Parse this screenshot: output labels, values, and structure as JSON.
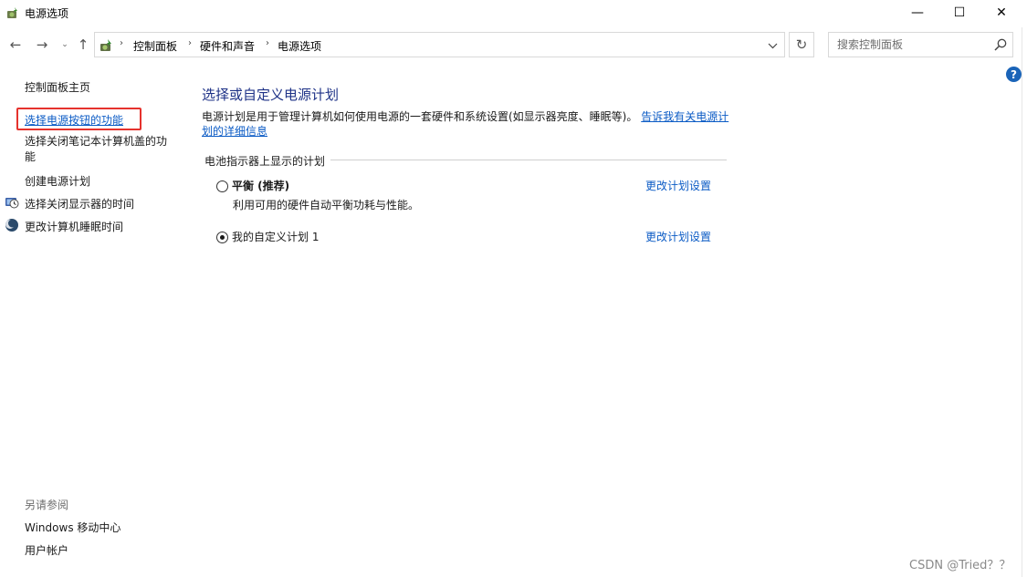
{
  "window": {
    "title": "电源选项",
    "minimize_glyph": "—",
    "maximize_glyph": "☐",
    "close_glyph": "✕"
  },
  "nav": {
    "back_glyph": "←",
    "forward_glyph": "→",
    "recent_glyph": "⌄",
    "up_glyph": "↑",
    "breadcrumbs": [
      "控制面板",
      "硬件和声音",
      "电源选项"
    ],
    "separator": "›",
    "refresh_glyph": "↻"
  },
  "search": {
    "placeholder": "搜索控制面板"
  },
  "help": {
    "glyph": "?"
  },
  "sidebar": {
    "home": "控制面板主页",
    "items": [
      {
        "label": "选择电源按钮的功能",
        "active": true
      },
      {
        "label": "选择关闭笔记本计算机盖的功能"
      },
      {
        "label": "创建电源计划"
      },
      {
        "label": "选择关闭显示器的时间",
        "icon": "monitor-clock-icon"
      },
      {
        "label": "更改计算机睡眠时间",
        "icon": "moon-icon"
      }
    ],
    "see_also_title": "另请参阅",
    "see_also": [
      "Windows 移动中心",
      "用户帐户"
    ]
  },
  "main": {
    "title": "选择或自定义电源计划",
    "description": "电源计划是用于管理计算机如何使用电源的一套硬件和系统设置(如显示器亮度、睡眠等)。",
    "description_link": "告诉我有关电源计划的详细信息",
    "section_label": "电池指示器上显示的计划",
    "plans": [
      {
        "name": "平衡 (推荐)",
        "description": "利用可用的硬件自动平衡功耗与性能。",
        "selected": false,
        "link": "更改计划设置"
      },
      {
        "name": "我的自定义计划 1",
        "selected": true,
        "link": "更改计划设置"
      }
    ]
  },
  "watermark": "CSDN @Tried？？",
  "colors": {
    "link": "#0b5bc5",
    "title": "#1e3287",
    "highlight": "#e5322d"
  }
}
